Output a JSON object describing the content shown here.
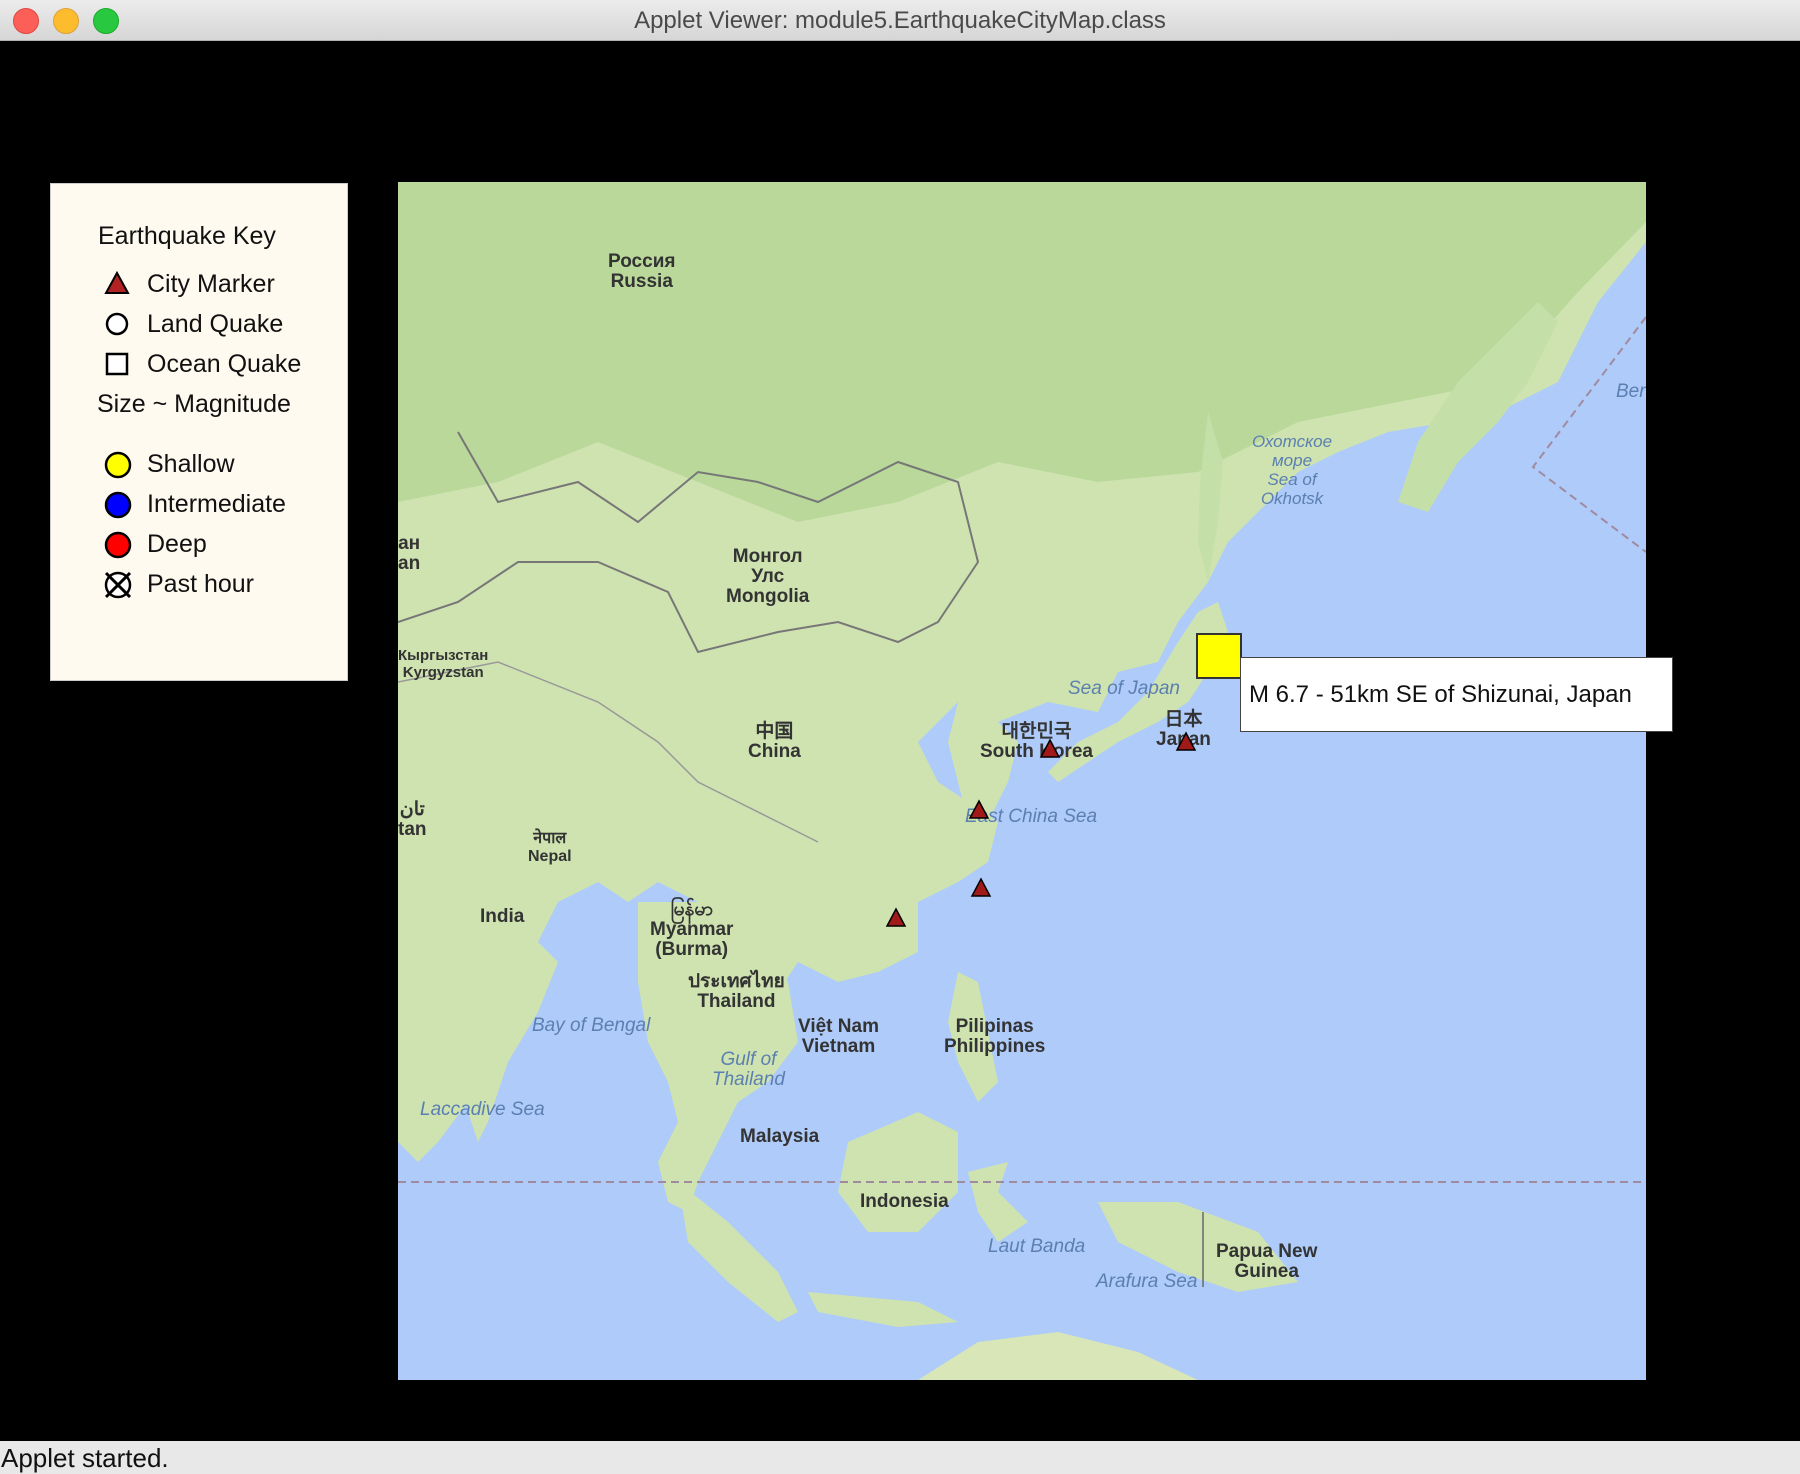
{
  "window": {
    "title": "Applet Viewer: module5.EarthquakeCityMap.class"
  },
  "legend": {
    "title": "Earthquake Key",
    "items": [
      {
        "label": "City Marker",
        "icon": "triangle-icon"
      },
      {
        "label": "Land Quake",
        "icon": "circle-icon"
      },
      {
        "label": "Ocean Quake",
        "icon": "square-icon"
      },
      {
        "label": "Size ~ Magnitude",
        "icon": ""
      },
      {
        "label": "Shallow",
        "icon": "yellow-circle-icon",
        "color": "#ffff00"
      },
      {
        "label": "Intermediate",
        "icon": "blue-circle-icon",
        "color": "#0000ff"
      },
      {
        "label": "Deep",
        "icon": "red-circle-icon",
        "color": "#ff0000"
      },
      {
        "label": "Past hour",
        "icon": "past-hour-icon"
      }
    ]
  },
  "map": {
    "labels": {
      "russia": "Россия\nRussia",
      "mongolia": "Монгол\nУлс\nMongolia",
      "china": "中国\nChina",
      "kyrgyzstan": "Кыргызстан\nKyrgyzstan",
      "nepal": "नेपाल\nNepal",
      "india": "India",
      "myanmar": "မြန်မာ\nMyanmar\n(Burma)",
      "thailand": "ประเทศไทย\nThailand",
      "vietnam": "Việt Nam\nVietnam",
      "philippines": "Pilipinas\nPhilippines",
      "malaysia": "Malaysia",
      "indonesia": "Indonesia",
      "png": "Papua New\nGuinea",
      "southkorea": "대한민국\nSouth Korea",
      "japan": "日本\nJapan",
      "an": "ан\nan",
      "tan": "تان\ntan"
    },
    "seas": {
      "okhotsk": "Охотское\nморе\nSea of\nOkhotsk",
      "seaofjapan": "Sea of Japan",
      "eastchina": "East China Sea",
      "bengal": "Bay of Bengal",
      "gulfthailand": "Gulf of\nThailand",
      "laccadive": "Laccadive Sea",
      "lautbanda": "Laut Banda",
      "arafura": "Arafura Sea",
      "ber": "Ber"
    }
  },
  "quake": {
    "tooltip": "M 6.7 - 51km SE of Shizunai, Japan",
    "color": "#ffff00",
    "type": "ocean",
    "depth": "Shallow"
  },
  "status": {
    "text": "Applet started."
  }
}
